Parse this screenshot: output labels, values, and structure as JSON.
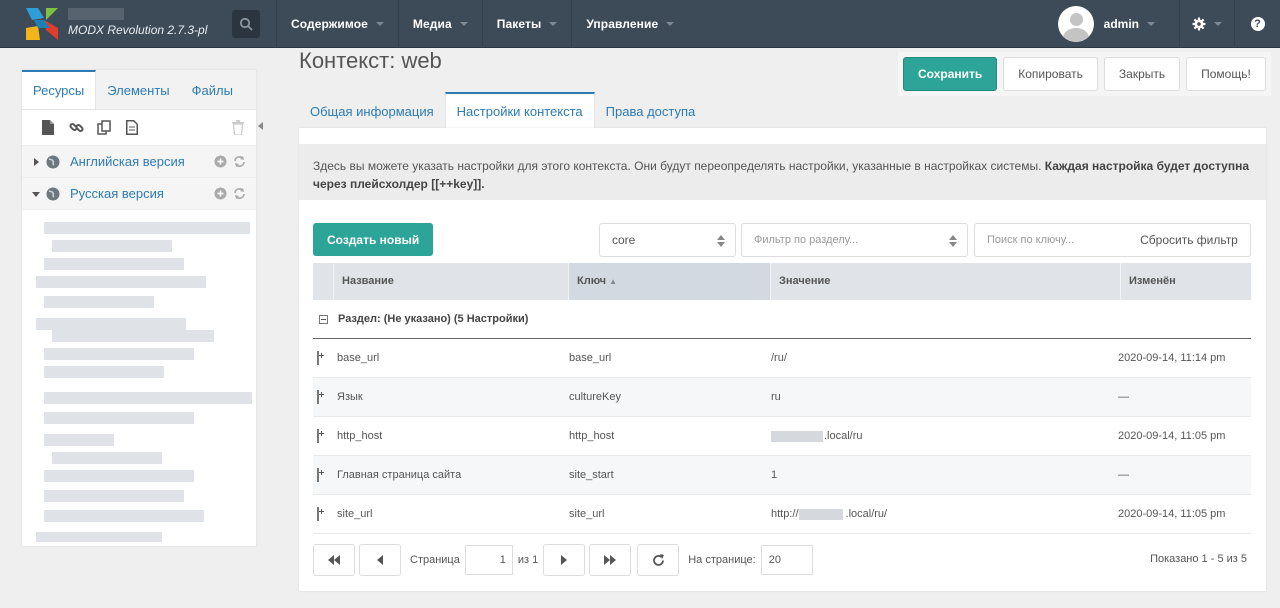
{
  "topbar": {
    "brand": "MODX Revolution 2.7.3-pl",
    "nav": [
      "Содержимое",
      "Медиа",
      "Пакеты",
      "Управление"
    ],
    "username": "admin",
    "help_label": "?"
  },
  "leftpanel": {
    "tabs": [
      "Ресурсы",
      "Элементы",
      "Файлы"
    ],
    "tree": [
      {
        "label": "Английская версия"
      },
      {
        "label": "Русская версия"
      }
    ]
  },
  "page": {
    "title": "Контекст: web",
    "buttons": {
      "save": "Сохранить",
      "copy": "Копировать",
      "close": "Закрыть",
      "help": "Помощь!"
    },
    "tabs": [
      "Общая информация",
      "Настройки контекста",
      "Права доступа"
    ]
  },
  "settings": {
    "description_plain": "Здесь вы можете указать настройки для этого контекста. Они будут переопределять настройки, указанные в настройках системы. ",
    "description_bold": "Каждая настройка будет доступна через плейсхолдер [[++key]].",
    "create_label": "Создать новый",
    "namespace_value": "core",
    "area_placeholder": "Фильтр по разделу...",
    "search_placeholder": "Поиск по ключу...",
    "reset_label": "Сбросить фильтр",
    "columns": [
      "Название",
      "Ключ",
      "Значение",
      "Изменён"
    ],
    "group_label": "Раздел: (Не указано) (5 Настройки)",
    "rows": [
      {
        "name": "base_url",
        "key": "base_url",
        "value": "/ru/",
        "edited": "2020-09-14, 11:14 pm"
      },
      {
        "name": "Язык",
        "key": "cultureKey",
        "value": "ru",
        "edited": "—"
      },
      {
        "name": "http_host",
        "key": "http_host",
        "value": ".local/ru",
        "edited": "2020-09-14, 11:05 pm"
      },
      {
        "name": "Главная страница сайта",
        "key": "site_start",
        "value": "1",
        "edited": "—"
      },
      {
        "name": "site_url",
        "key": "site_url",
        "value_prefix": "http://",
        "value": ".local/ru/",
        "edited": "2020-09-14, 11:05 pm"
      }
    ],
    "pager": {
      "page_label": "Страница",
      "page_value": "1",
      "of_label": "из 1",
      "per_page_label": "На странице:",
      "per_page_value": "20",
      "info": "Показано 1 - 5 из 5"
    }
  }
}
